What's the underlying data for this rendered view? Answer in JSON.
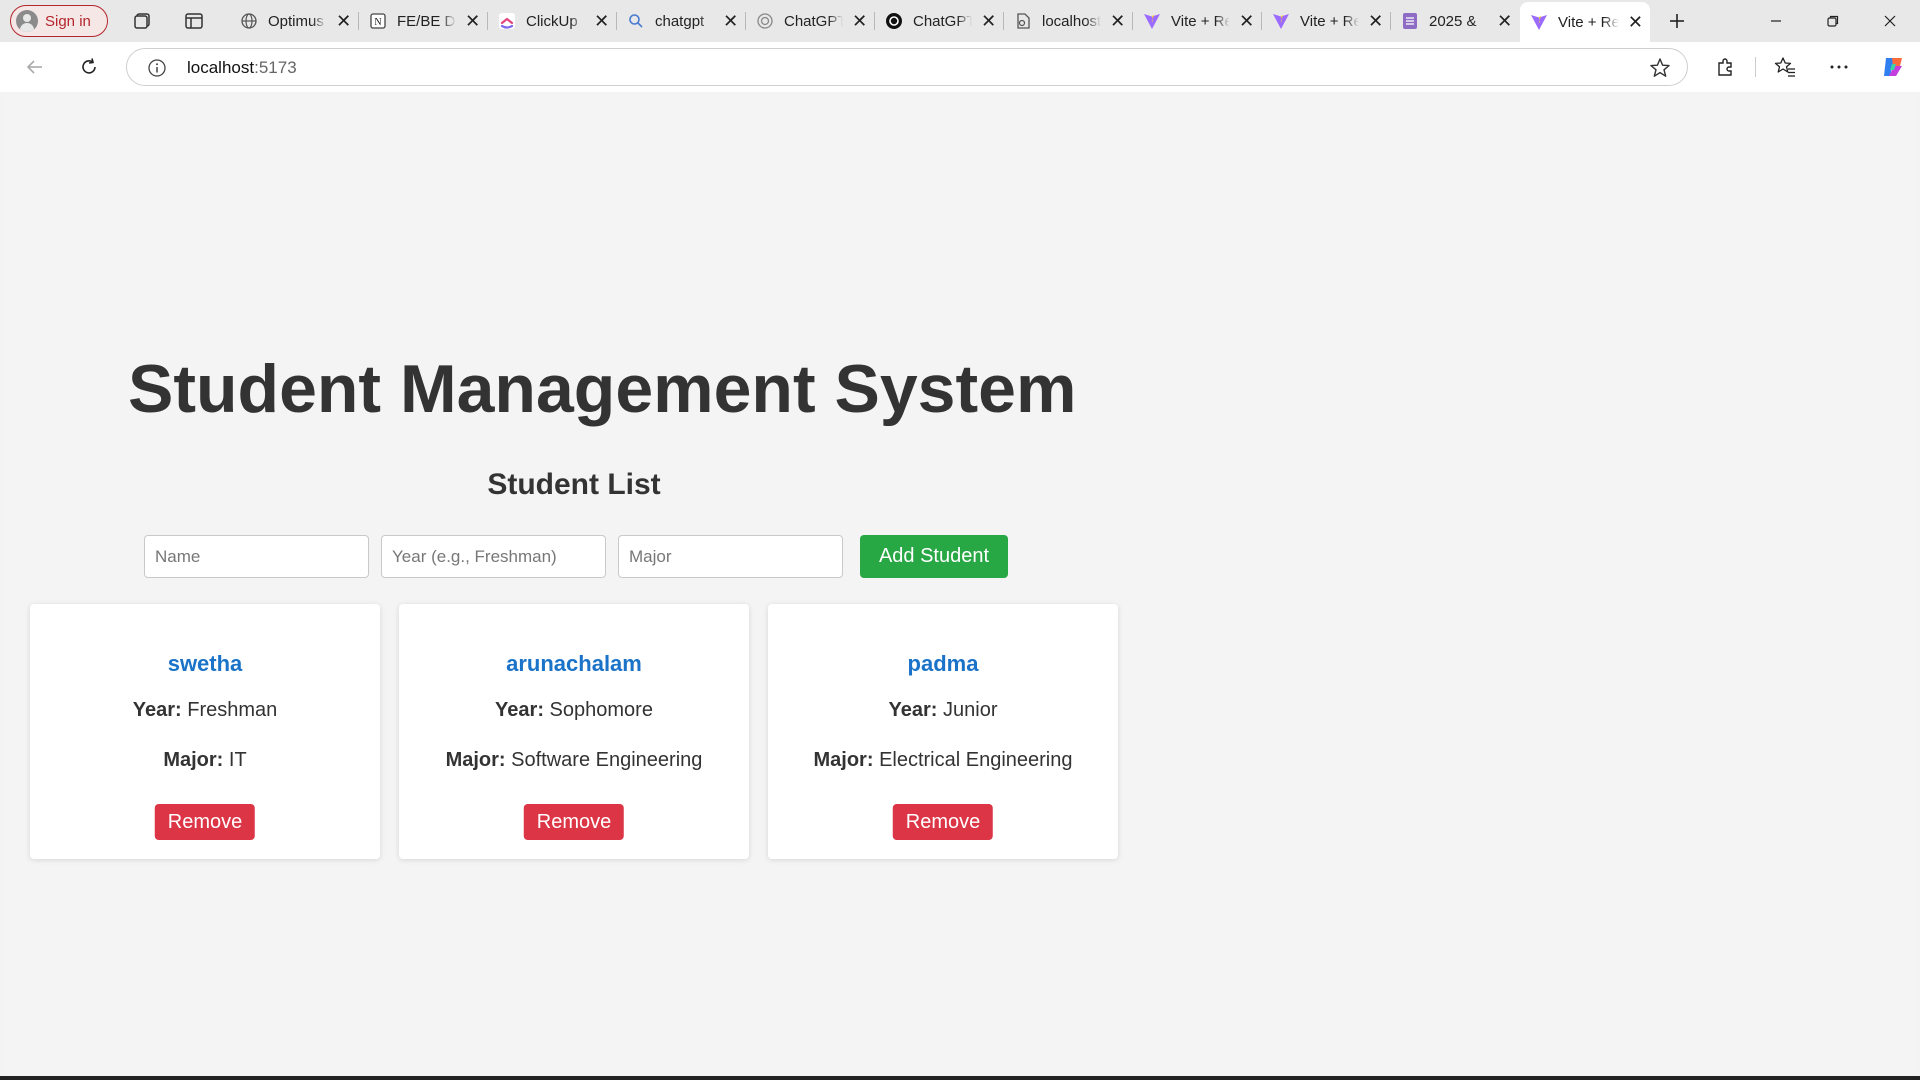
{
  "browser": {
    "sign_in_label": "Sign in",
    "tabs": [
      {
        "title": "Optimus",
        "icon": "globe-icon"
      },
      {
        "title": "FE/BE Dev",
        "icon": "notion-icon"
      },
      {
        "title": "ClickUp",
        "icon": "clickup-icon"
      },
      {
        "title": "chatgpt",
        "icon": "search-icon"
      },
      {
        "title": "ChatGPT",
        "icon": "chatgpt-icon"
      },
      {
        "title": "ChatGPT",
        "icon": "openai-icon"
      },
      {
        "title": "localhost",
        "icon": "page-icon"
      },
      {
        "title": "Vite + React",
        "icon": "vite-icon"
      },
      {
        "title": "Vite + React",
        "icon": "vite-icon"
      },
      {
        "title": "2025 &",
        "icon": "forms-icon"
      },
      {
        "title": "Vite + React",
        "icon": "vite-icon",
        "active": true
      }
    ],
    "address": {
      "host": "localhost",
      "port": ":5173"
    }
  },
  "page": {
    "title": "Student Management System",
    "list_title": "Student List",
    "form": {
      "name_placeholder": "Name",
      "year_placeholder": "Year (e.g., Freshman)",
      "major_placeholder": "Major",
      "add_label": "Add Student"
    },
    "year_label": "Year:",
    "major_label": "Major:",
    "remove_label": "Remove",
    "students": [
      {
        "name": "swetha",
        "year": "Freshman",
        "major": "IT"
      },
      {
        "name": "arunachalam",
        "year": "Sophomore",
        "major": "Software Engineering"
      },
      {
        "name": "padma",
        "year": "Junior",
        "major": "Electrical Engineering"
      }
    ]
  },
  "colors": {
    "add_button": "#28a745",
    "remove_button": "#dc3545",
    "student_name": "#1a73c8"
  }
}
